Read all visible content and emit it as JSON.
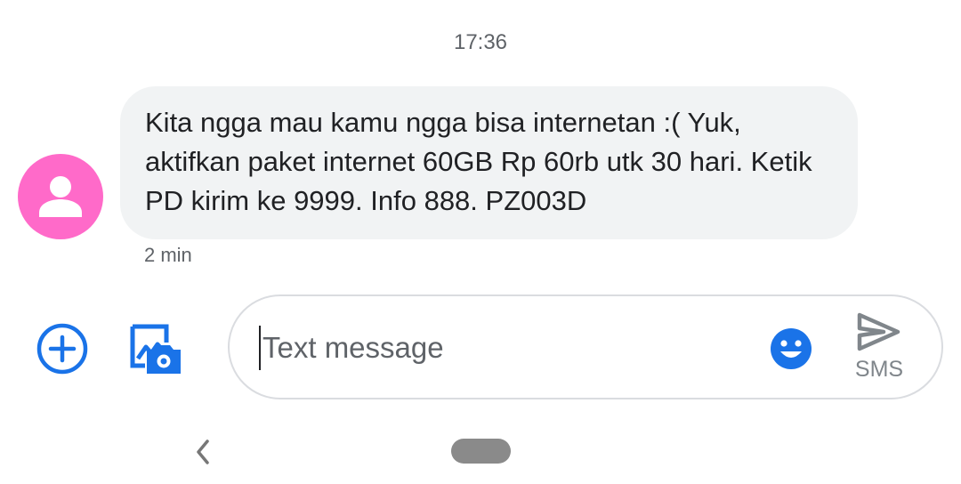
{
  "conversation": {
    "timestamp": "17:36"
  },
  "message": {
    "text": "Kita ngga mau kamu ngga bisa internetan :( Yuk, aktifkan paket internet 60GB Rp 60rb utk 30 hari. Ketik PD kirim ke 9999. Info 888. PZ003D",
    "time_ago": "2 min",
    "avatar_color": "#ff6ac9",
    "avatar_icon": "person-icon"
  },
  "composer": {
    "placeholder": "Text message",
    "value": "",
    "send_label": "SMS",
    "icons": {
      "add": "add-circle-icon",
      "gallery": "gallery-camera-icon",
      "emoji": "emoji-icon",
      "send": "send-icon"
    },
    "accent_color": "#1a73e8"
  },
  "navigation": {
    "back_icon": "back-chevron-icon",
    "home_icon": "home-pill"
  }
}
